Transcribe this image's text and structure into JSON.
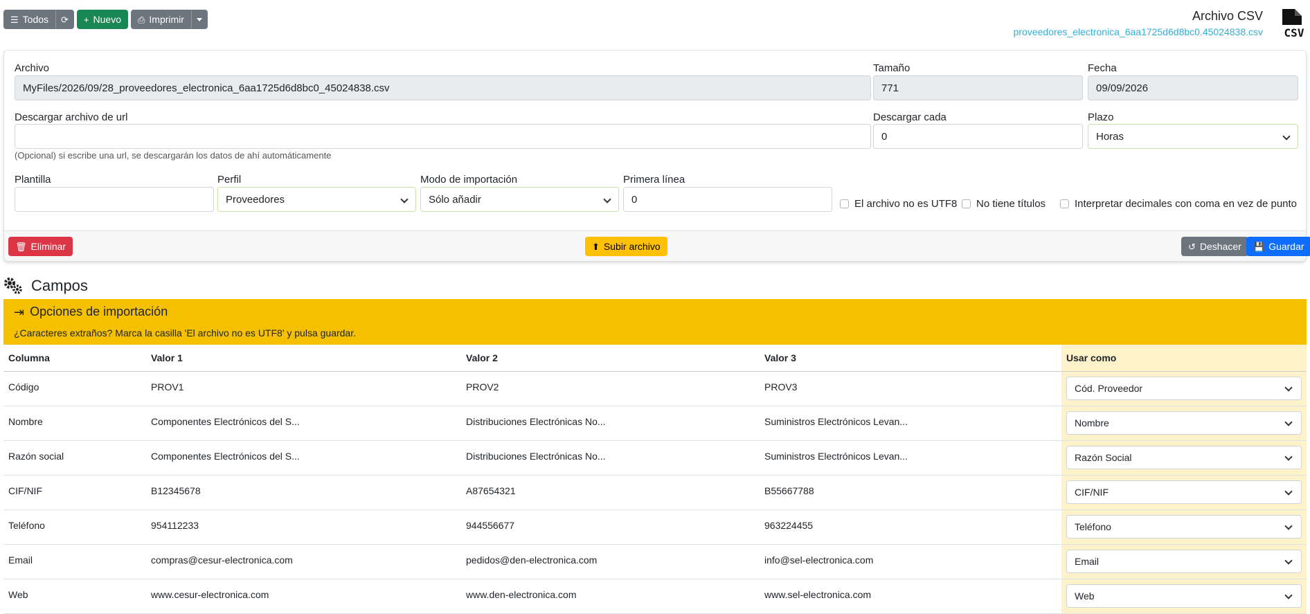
{
  "toolbar": {
    "todos_label": "Todos",
    "nuevo_label": "Nuevo",
    "imprimir_label": "Imprimir"
  },
  "header": {
    "title": "Archivo CSV",
    "filename": "proveedores_electronica_6aa1725d6d8bc0.45024838.csv",
    "icon_text": "CSV"
  },
  "form": {
    "archivo_label": "Archivo",
    "archivo_value": "MyFiles/2026/09/28_proveedores_electronica_6aa1725d6d8bc0_45024838.csv",
    "tamano_label": "Tamaño",
    "tamano_value": "771",
    "fecha_label": "Fecha",
    "fecha_value": "09/09/2026",
    "url_label": "Descargar archivo de url",
    "url_value": "",
    "url_help": "(Opcional) si escribe una url, se descargarán los datos de ahí automáticamente",
    "cada_label": "Descargar cada",
    "cada_value": "0",
    "plazo_label": "Plazo",
    "plazo_value": "Horas",
    "plantilla_label": "Plantilla",
    "plantilla_value": "",
    "perfil_label": "Perfil",
    "perfil_value": "Proveedores",
    "modo_label": "Modo de importación",
    "modo_value": "Sólo añadir",
    "primera_label": "Primera línea",
    "primera_value": "0",
    "chk_utf8": "El archivo no es UTF8",
    "chk_titulos": "No tiene títulos",
    "chk_decimales": "Interpretar decimales con coma en vez de punto"
  },
  "footer": {
    "eliminar_label": "Eliminar",
    "subir_label": "Subir archivo",
    "deshacer_label": "Deshacer",
    "guardar_label": "Guardar"
  },
  "campos": {
    "title": "Campos"
  },
  "options": {
    "title": "Opciones de importación",
    "subtitle": "¿Caracteres extraños? Marca la casilla 'El archivo no es UTF8' y pulsa guardar."
  },
  "table": {
    "headers": [
      "Columna",
      "Valor 1",
      "Valor 2",
      "Valor 3",
      "Usar como"
    ],
    "rows": [
      {
        "col": "Código",
        "v1": "PROV1",
        "v2": "PROV2",
        "v3": "PROV3",
        "use": "Cód. Proveedor"
      },
      {
        "col": "Nombre",
        "v1": "Componentes Electrónicos del S...",
        "v2": "Distribuciones Electrónicas No...",
        "v3": "Suministros Electrónicos Levan...",
        "use": "Nombre"
      },
      {
        "col": "Razón social",
        "v1": "Componentes Electrónicos del S...",
        "v2": "Distribuciones Electrónicas No...",
        "v3": "Suministros Electrónicos Levan...",
        "use": "Razón Social"
      },
      {
        "col": "CIF/NIF",
        "v1": "B12345678",
        "v2": "A87654321",
        "v3": "B55667788",
        "use": "CIF/NIF"
      },
      {
        "col": "Teléfono",
        "v1": "954112233",
        "v2": "944556677",
        "v3": "963224455",
        "use": "Teléfono"
      },
      {
        "col": "Email",
        "v1": "compras@cesur-electronica.com",
        "v2": "pedidos@den-electronica.com",
        "v3": "info@sel-electronica.com",
        "use": "Email"
      },
      {
        "col": "Web",
        "v1": "www.cesur-electronica.com",
        "v2": "www.den-electronica.com",
        "v3": "www.sel-electronica.com",
        "use": "Web"
      }
    ]
  }
}
